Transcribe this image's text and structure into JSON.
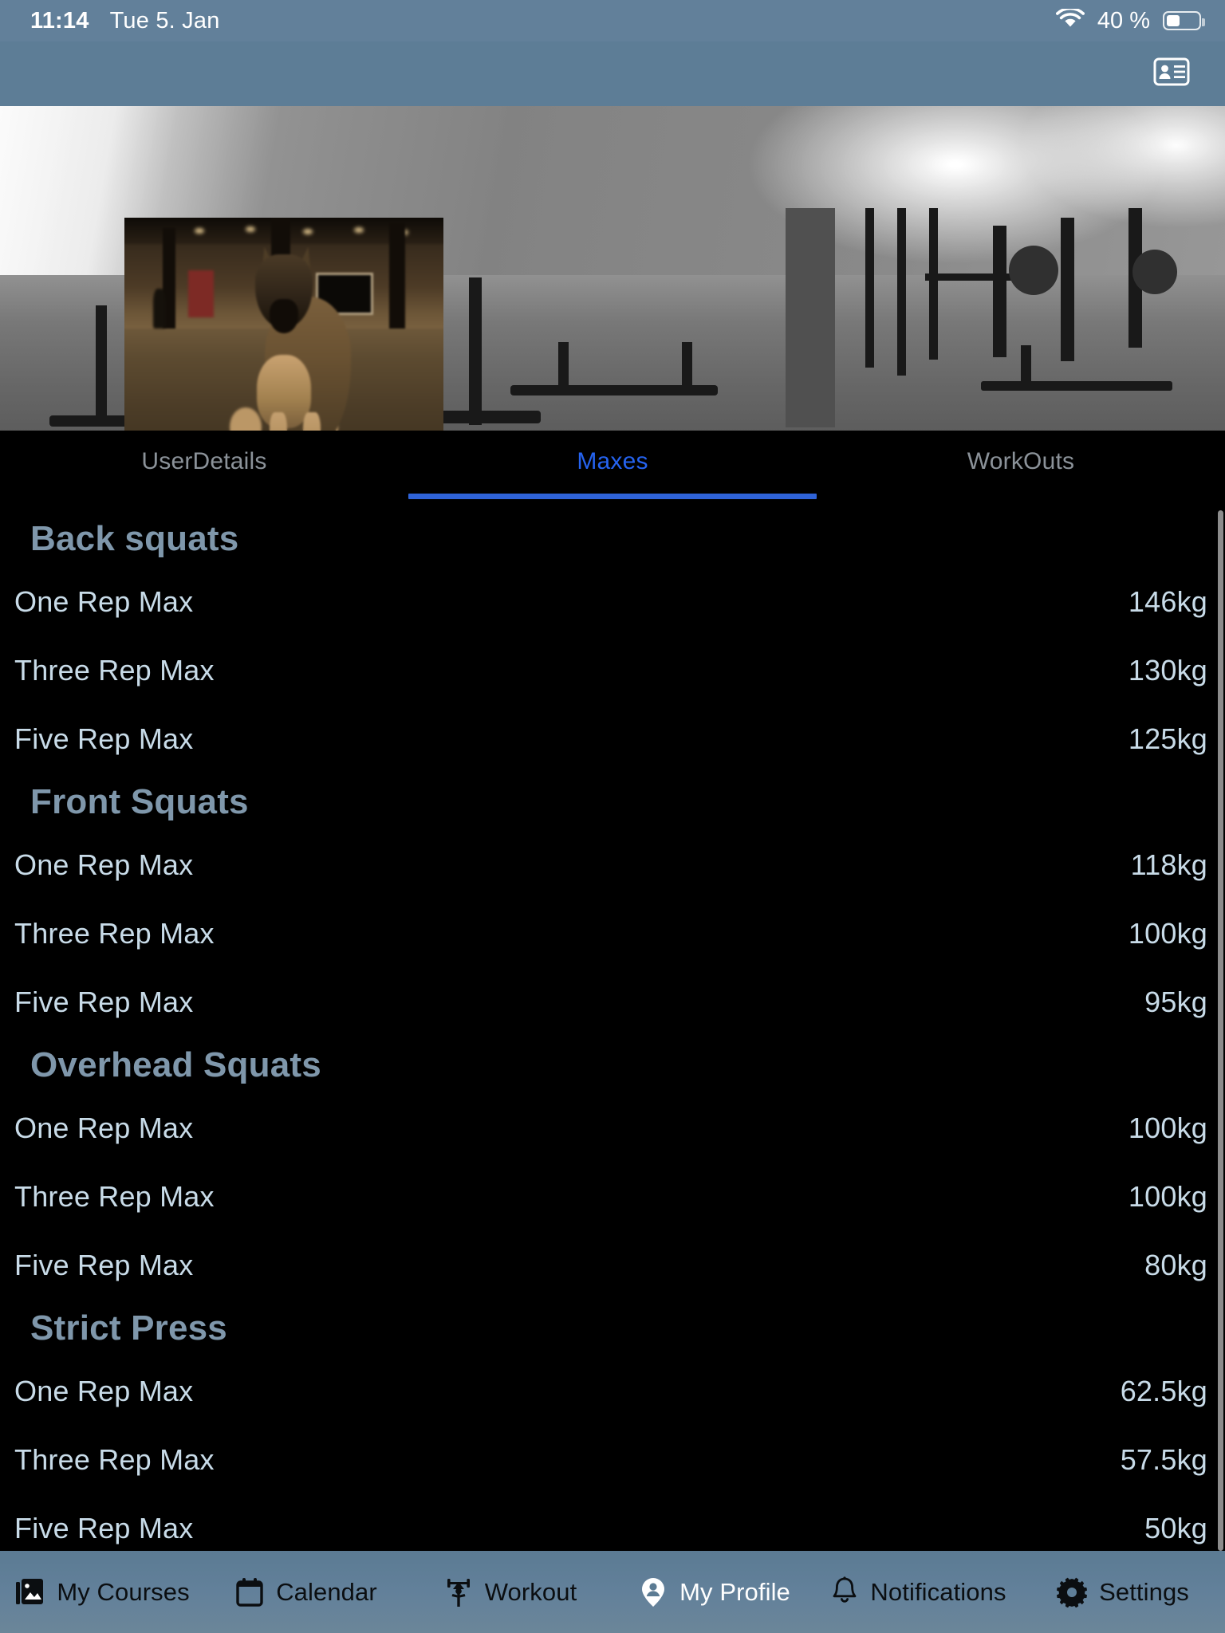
{
  "status_bar": {
    "time": "11:14",
    "date": "Tue 5. Jan",
    "battery_percent": "40 %",
    "battery_level": 40,
    "wifi_icon": "wifi-icon",
    "battery_icon": "battery-icon"
  },
  "nav_bar": {
    "action_icon": "contact-card-icon",
    "background_color": "#5d7d96"
  },
  "hero": {
    "background_description": "gym-interior-grayscale",
    "profile_photo_description": "german-shepherd-dog-photo"
  },
  "tabs": [
    {
      "label": "UserDetails",
      "active": false
    },
    {
      "label": "Maxes",
      "active": true
    },
    {
      "label": "WorkOuts",
      "active": false
    }
  ],
  "colors": {
    "accent": "#2563f0",
    "underline": "#2f63d8",
    "section_header": "#7f97ab",
    "row_text": "#c8dbe8",
    "tab_inactive": "#8b9299",
    "background": "#000000",
    "bar_blue": "#62809a"
  },
  "sections": [
    {
      "title": "Back squats",
      "rows": [
        {
          "label": "One Rep Max",
          "value": "146kg"
        },
        {
          "label": "Three Rep Max",
          "value": "130kg"
        },
        {
          "label": "Five Rep Max",
          "value": "125kg"
        }
      ]
    },
    {
      "title": "Front Squats",
      "rows": [
        {
          "label": "One Rep Max",
          "value": "118kg"
        },
        {
          "label": "Three Rep Max",
          "value": "100kg"
        },
        {
          "label": "Five Rep Max",
          "value": "95kg"
        }
      ]
    },
    {
      "title": "Overhead Squats",
      "rows": [
        {
          "label": "One Rep Max",
          "value": "100kg"
        },
        {
          "label": "Three Rep Max",
          "value": "100kg"
        },
        {
          "label": "Five Rep Max",
          "value": "80kg"
        }
      ]
    },
    {
      "title": "Strict Press",
      "rows": [
        {
          "label": "One Rep Max",
          "value": "62.5kg"
        },
        {
          "label": "Three Rep Max",
          "value": "57.5kg"
        },
        {
          "label": "Five Rep Max",
          "value": "50kg"
        }
      ]
    }
  ],
  "bottom_bar": [
    {
      "label": "My Courses",
      "icon": "photo-library-icon",
      "active": false
    },
    {
      "label": "Calendar",
      "icon": "calendar-icon",
      "active": false
    },
    {
      "label": "Workout",
      "icon": "weightlifter-icon",
      "active": false
    },
    {
      "label": "My Profile",
      "icon": "person-pin-icon",
      "active": true
    },
    {
      "label": "Notifications",
      "icon": "bell-icon",
      "active": false
    },
    {
      "label": "Settings",
      "icon": "gear-icon",
      "active": false
    }
  ]
}
